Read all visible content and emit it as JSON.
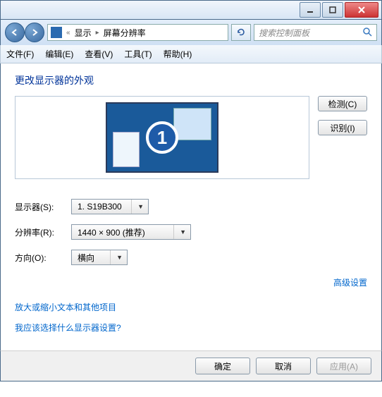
{
  "titlebar": {
    "min": "—",
    "max": "☐",
    "close": "✕"
  },
  "nav": {
    "back_chev": "«",
    "crumb1": "显示",
    "sep": "▸",
    "crumb2": "屏幕分辨率",
    "search_placeholder": "搜索控制面板"
  },
  "menu": {
    "file": "文件(F)",
    "edit": "编辑(E)",
    "view": "查看(V)",
    "tools": "工具(T)",
    "help": "帮助(H)"
  },
  "heading": "更改显示器的外观",
  "monitor_number": "1",
  "buttons": {
    "detect": "检测(C)",
    "identify": "识别(I)",
    "ok": "确定",
    "cancel": "取消",
    "apply": "应用(A)"
  },
  "form": {
    "display_label": "显示器(S):",
    "display_value": "1. S19B300",
    "resolution_label": "分辨率(R):",
    "resolution_value": "1440 × 900 (推荐)",
    "orientation_label": "方向(O):",
    "orientation_value": "横向"
  },
  "links": {
    "advanced": "高级设置",
    "text_size": "放大或缩小文本和其他项目",
    "which_settings": "我应该选择什么显示器设置?"
  }
}
